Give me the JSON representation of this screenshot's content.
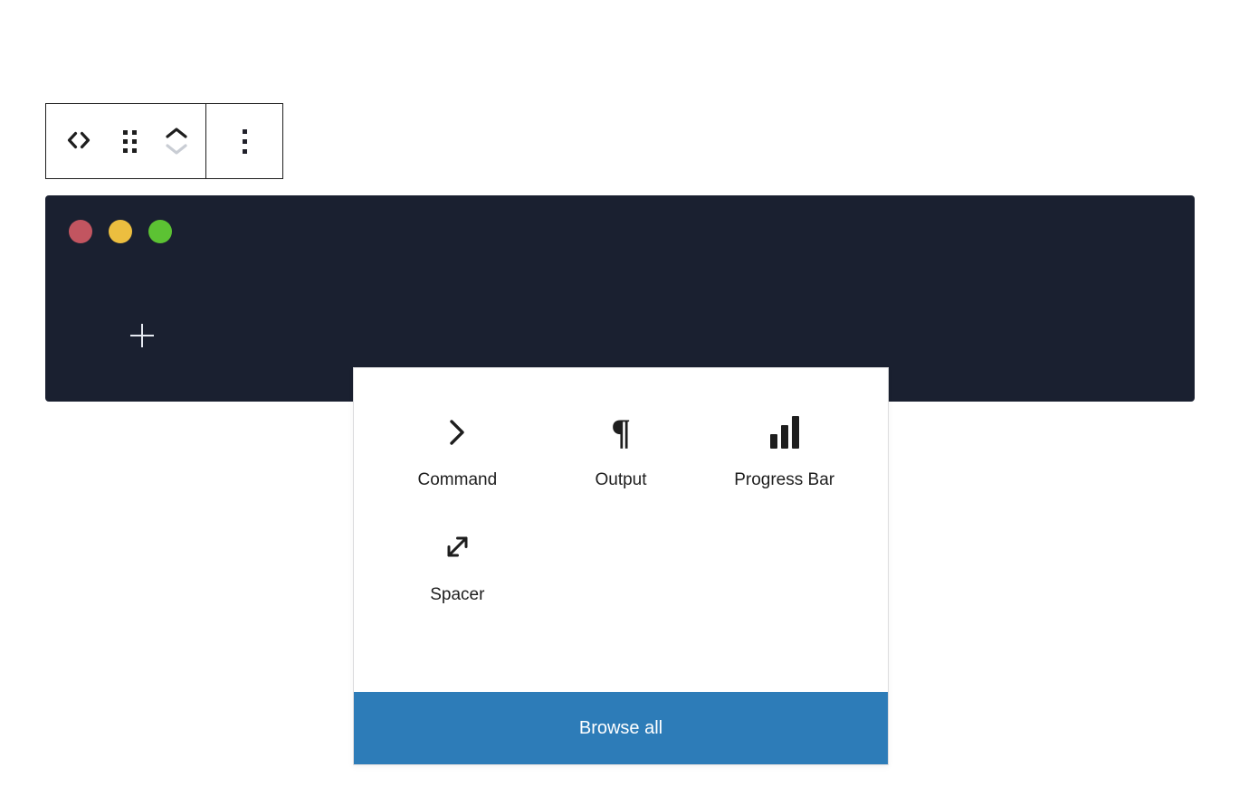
{
  "block_toolbar": {
    "code_button": {
      "icon": "code-icon",
      "label": ""
    },
    "drag_handle": {
      "icon": "drag-handle-icon",
      "label": ""
    },
    "move_up": {
      "icon": "chevron-up-icon",
      "label": ""
    },
    "move_down": {
      "icon": "chevron-down-icon",
      "label": ""
    },
    "options": {
      "icon": "ellipsis-vertical-icon",
      "label": ""
    }
  },
  "terminal_block": {
    "window_controls": [
      {
        "name": "close",
        "color": "#c25560"
      },
      {
        "name": "minimize",
        "color": "#ecbe3f"
      },
      {
        "name": "maximize",
        "color": "#5cc233"
      }
    ],
    "background": "#1a2030",
    "appender": {
      "icon": "plus-icon",
      "label": ""
    }
  },
  "inserter": {
    "blocks": [
      {
        "label": "Command",
        "icon": "chevron-right-icon"
      },
      {
        "label": "Output",
        "icon": "pilcrow-icon"
      },
      {
        "label": "Progress Bar",
        "icon": "bar-chart-icon"
      },
      {
        "label": "Spacer",
        "icon": "diagonal-resize-icon"
      }
    ],
    "browse_all_label": "Browse all",
    "accent_color": "#2d7cb8"
  }
}
